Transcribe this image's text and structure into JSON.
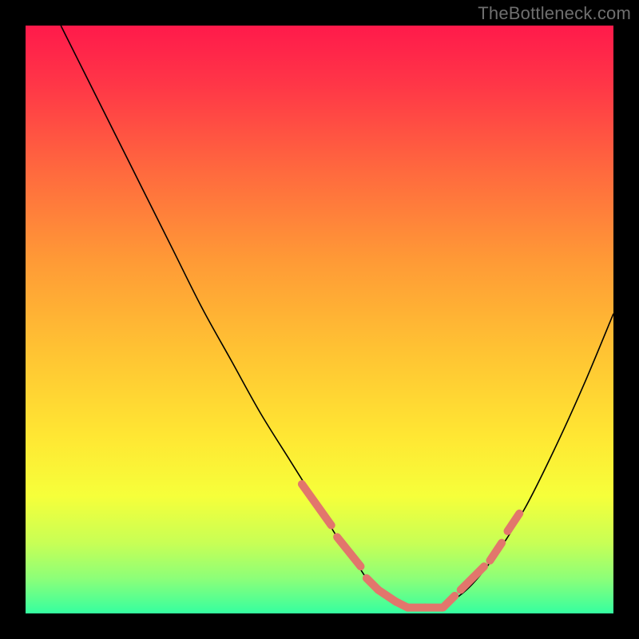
{
  "watermark": "TheBottleneck.com",
  "gradient": {
    "stops": [
      {
        "offset": "0%",
        "color": "#ff1a4b"
      },
      {
        "offset": "10%",
        "color": "#ff3647"
      },
      {
        "offset": "25%",
        "color": "#ff6a3e"
      },
      {
        "offset": "40%",
        "color": "#ff9a36"
      },
      {
        "offset": "55%",
        "color": "#ffc233"
      },
      {
        "offset": "70%",
        "color": "#ffe733"
      },
      {
        "offset": "80%",
        "color": "#f6ff3a"
      },
      {
        "offset": "88%",
        "color": "#c8ff55"
      },
      {
        "offset": "94%",
        "color": "#8dff78"
      },
      {
        "offset": "100%",
        "color": "#35ffa0"
      }
    ]
  },
  "curve_style": {
    "stroke": "#000000",
    "stroke_width": 1.6
  },
  "marker_style": {
    "stroke": "#e2766c",
    "stroke_width": 10,
    "linecap": "round"
  },
  "chart_data": {
    "type": "line",
    "title": "",
    "xlabel": "",
    "ylabel": "",
    "xlim": [
      0,
      100
    ],
    "ylim": [
      0,
      100
    ],
    "grid": false,
    "legend": false,
    "series": [
      {
        "name": "bottleneck-curve",
        "x": [
          6,
          10,
          15,
          20,
          25,
          30,
          35,
          40,
          45,
          50,
          53,
          56,
          58,
          60,
          63,
          66,
          70,
          75,
          80,
          85,
          90,
          95,
          100
        ],
        "y": [
          100,
          92,
          82,
          72,
          62,
          52,
          43,
          34,
          26,
          18,
          13,
          9,
          6,
          4,
          2,
          1,
          1,
          4,
          10,
          18,
          28,
          39,
          51
        ]
      }
    ],
    "markers": [
      {
        "x0": 47,
        "y0": 22,
        "x1": 52,
        "y1": 15
      },
      {
        "x0": 53,
        "y0": 13,
        "x1": 57,
        "y1": 8
      },
      {
        "x0": 58,
        "y0": 6,
        "x1": 60,
        "y1": 4
      },
      {
        "x0": 60,
        "y0": 4,
        "x1": 63,
        "y1": 2
      },
      {
        "x0": 63,
        "y0": 2,
        "x1": 65,
        "y1": 1
      },
      {
        "x0": 65,
        "y0": 1,
        "x1": 68,
        "y1": 1
      },
      {
        "x0": 68,
        "y0": 1,
        "x1": 71,
        "y1": 1
      },
      {
        "x0": 71,
        "y0": 1,
        "x1": 73,
        "y1": 3
      },
      {
        "x0": 74,
        "y0": 4,
        "x1": 78,
        "y1": 8
      },
      {
        "x0": 79,
        "y0": 9,
        "x1": 81,
        "y1": 12
      },
      {
        "x0": 82,
        "y0": 14,
        "x1": 84,
        "y1": 17
      }
    ]
  }
}
